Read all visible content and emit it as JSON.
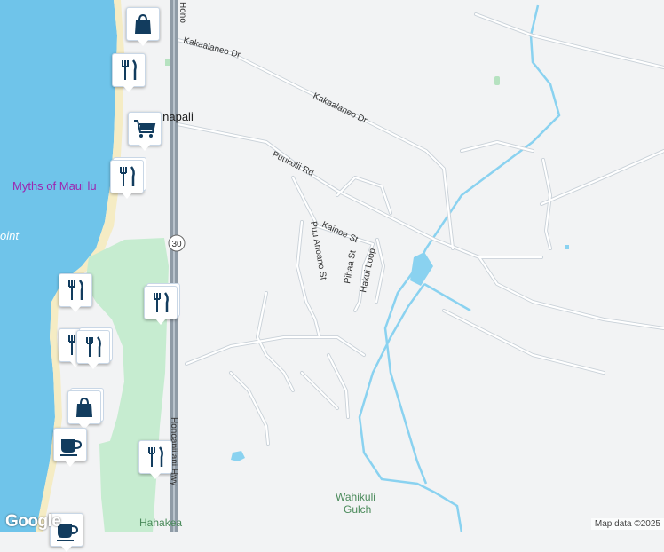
{
  "streets": {
    "kakaalaneo_upper": "Kakaalaneo Dr",
    "kakaalaneo_lower": "Kakaalaneo Dr",
    "puukolii": "Puukolii Rd",
    "kainoe": "Kainoe St",
    "puu_anoano": "Puu Anoano St",
    "pihaa": "Pihaa St",
    "hakui": "Hakui Loop",
    "highway_top": "Hono",
    "highway_bottom": "Honoapiilani Hwy",
    "route_shield": "30"
  },
  "places": {
    "kaanapali": "Kaanapali",
    "myths": "Myths of Maui lu",
    "point": "oint",
    "wahikuli_1": "Wahikuli",
    "wahikuli_2": "Gulch",
    "hahakea": "Hahakea"
  },
  "pins": [
    {
      "icon": "shopping-bag-icon"
    },
    {
      "icon": "restaurant-icon"
    },
    {
      "icon": "shopping-cart-icon"
    },
    {
      "icon": "restaurant-icon"
    },
    {
      "icon": "restaurant-icon"
    },
    {
      "icon": "restaurant-icon"
    },
    {
      "icon": "restaurant-icon"
    },
    {
      "icon": "restaurant-icon"
    },
    {
      "icon": "shopping-bag-icon"
    },
    {
      "icon": "cafe-icon"
    },
    {
      "icon": "restaurant-icon"
    },
    {
      "icon": "cafe-icon"
    }
  ],
  "attribution": {
    "logo": "Google",
    "credit": "Map data ©2025"
  },
  "colors": {
    "ocean": "#6fc4ea",
    "park": "#c6ecd0",
    "stream": "#8ad2f0",
    "road": "#ffffff",
    "road_casing": "#c9d1d8",
    "highway": "#8f9ba6",
    "pin_icon": "#123c5e",
    "place_label": "#9c27b0"
  }
}
